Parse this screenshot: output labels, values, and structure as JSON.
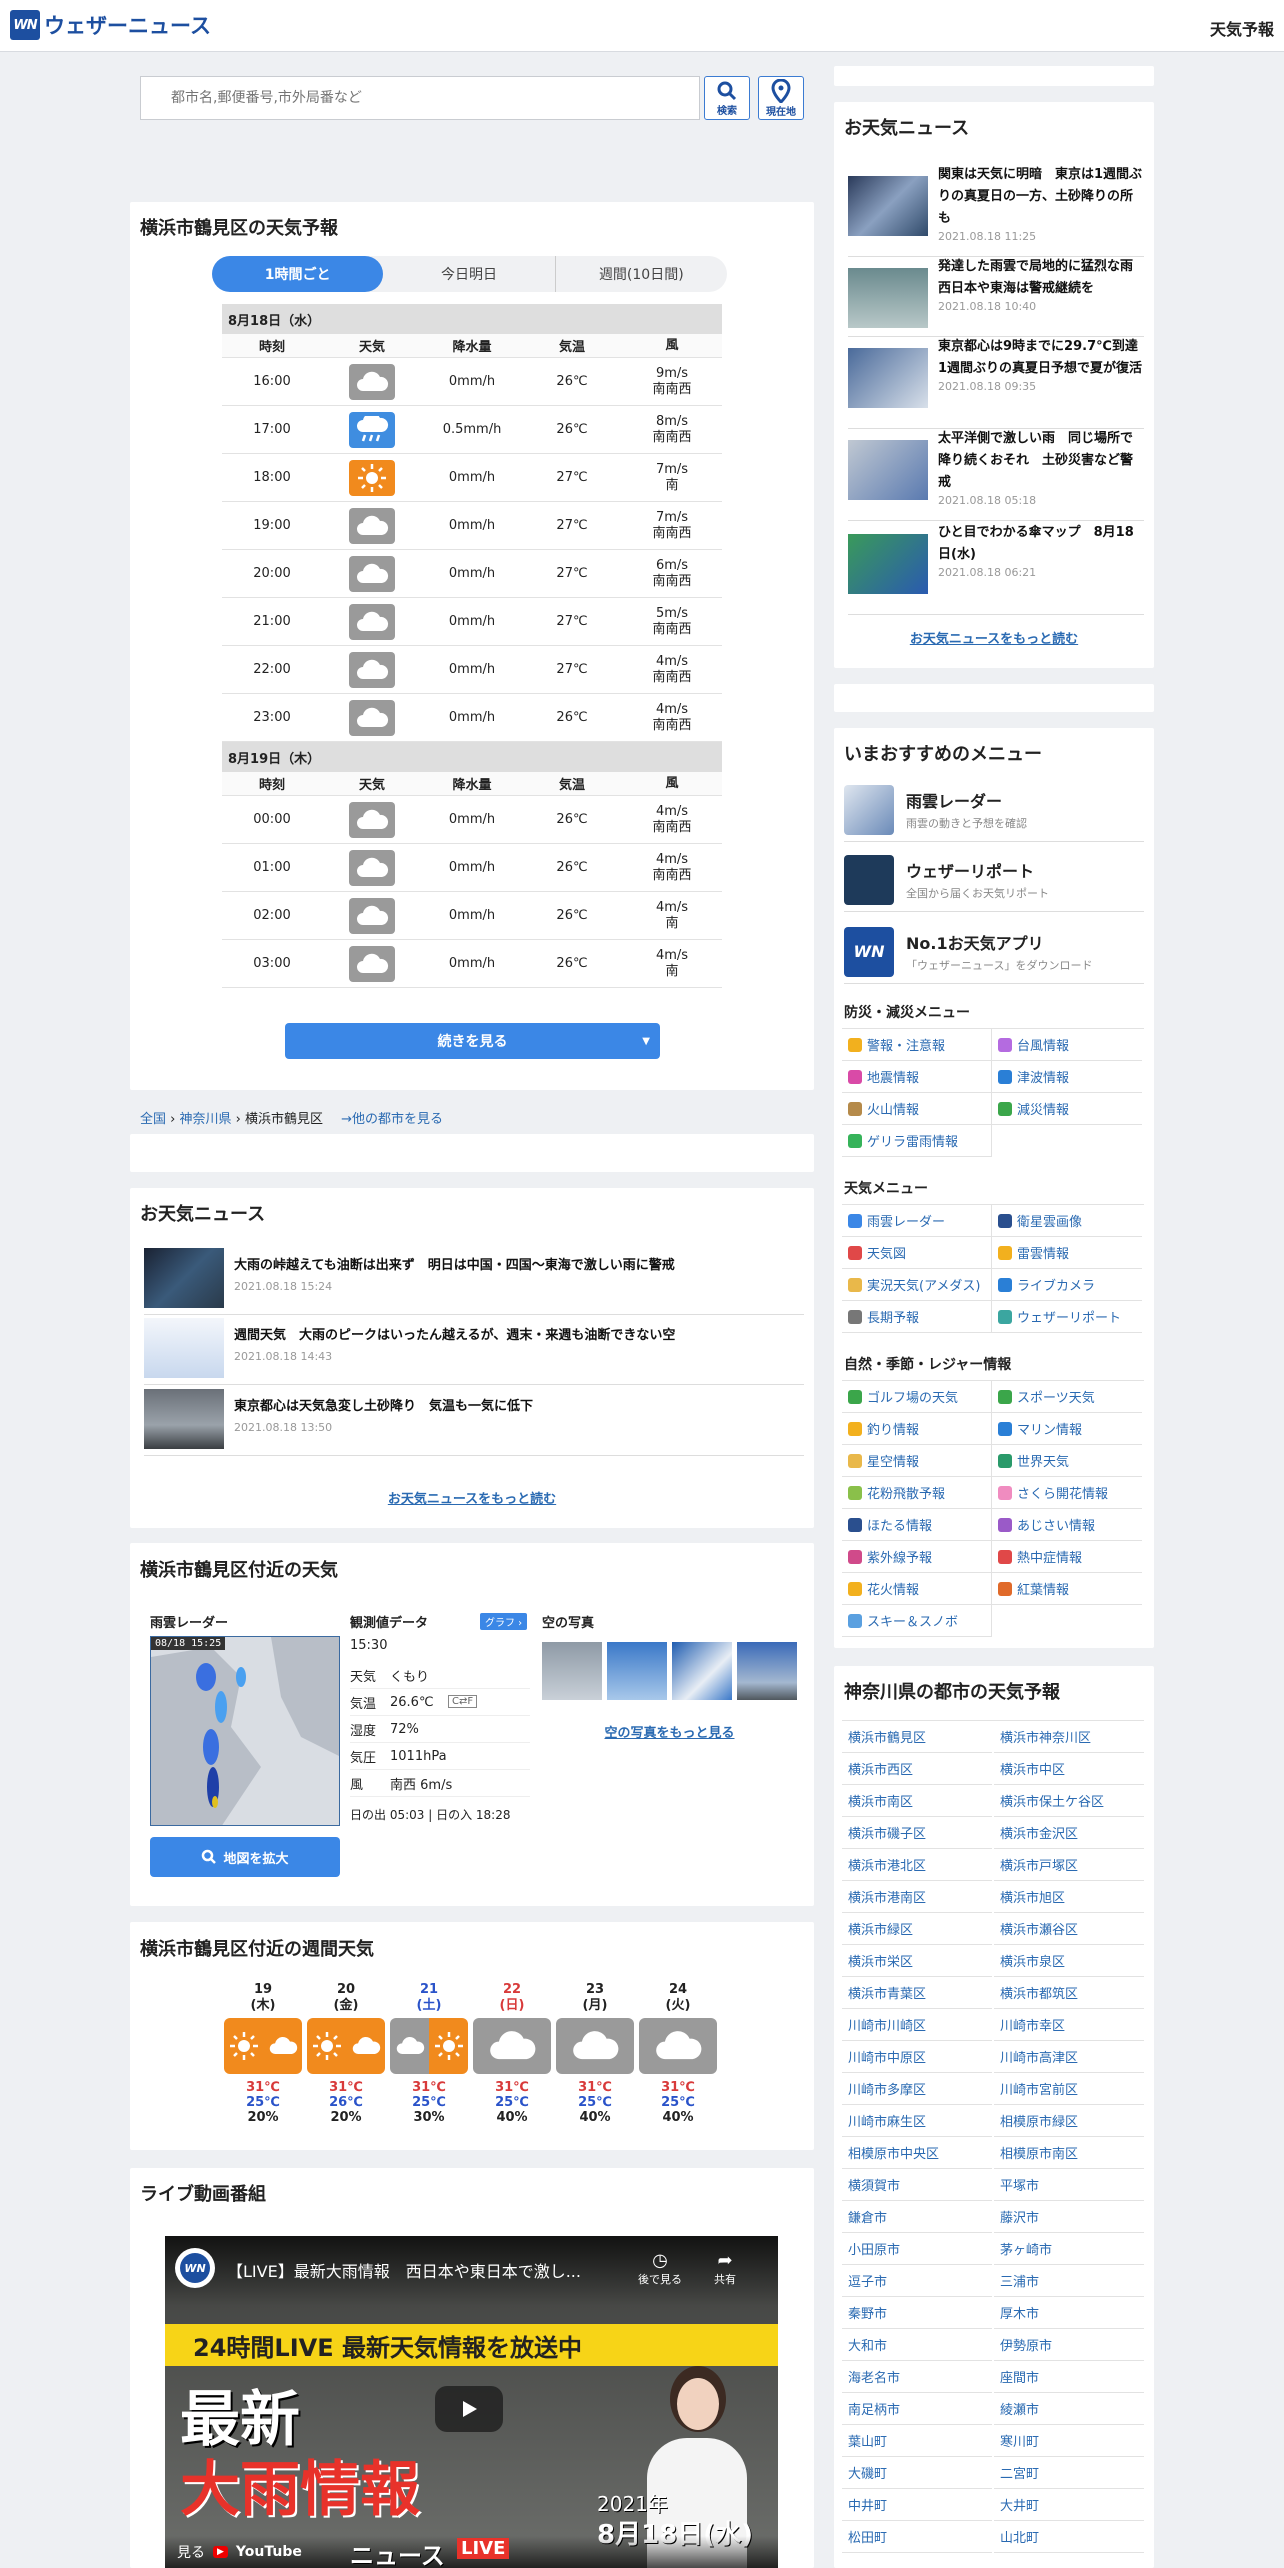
{
  "header": {
    "logo_mark": "WN",
    "logo_text": "ウェザーニュース",
    "right_label": "天気予報"
  },
  "search": {
    "placeholder": "都市名,郵便番号,市外局番など",
    "search_label": "検索",
    "location_label": "現在地"
  },
  "forecast": {
    "title": "横浜市鶴見区の天気予報",
    "tabs": [
      "1時間ごと",
      "今日明日",
      "週間(10日間)"
    ],
    "col_headers": [
      "時刻",
      "天気",
      "降水量",
      "気温",
      "風"
    ],
    "days": [
      {
        "label": "8月18日（水）",
        "rows": [
          {
            "time": "16:00",
            "weather": "cloudy",
            "precip": "0mm/h",
            "temp": "26℃",
            "wind_speed": "9m/s",
            "wind_dir": "南南西"
          },
          {
            "time": "17:00",
            "weather": "rain",
            "precip": "0.5mm/h",
            "temp": "26℃",
            "wind_speed": "8m/s",
            "wind_dir": "南南西"
          },
          {
            "time": "18:00",
            "weather": "sunny",
            "precip": "0mm/h",
            "temp": "27℃",
            "wind_speed": "7m/s",
            "wind_dir": "南"
          },
          {
            "time": "19:00",
            "weather": "cloudy",
            "precip": "0mm/h",
            "temp": "27℃",
            "wind_speed": "7m/s",
            "wind_dir": "南南西"
          },
          {
            "time": "20:00",
            "weather": "cloudy",
            "precip": "0mm/h",
            "temp": "27℃",
            "wind_speed": "6m/s",
            "wind_dir": "南南西"
          },
          {
            "time": "21:00",
            "weather": "cloudy",
            "precip": "0mm/h",
            "temp": "27℃",
            "wind_speed": "5m/s",
            "wind_dir": "南南西"
          },
          {
            "time": "22:00",
            "weather": "cloudy",
            "precip": "0mm/h",
            "temp": "27℃",
            "wind_speed": "4m/s",
            "wind_dir": "南南西"
          },
          {
            "time": "23:00",
            "weather": "cloudy",
            "precip": "0mm/h",
            "temp": "26℃",
            "wind_speed": "4m/s",
            "wind_dir": "南南西"
          }
        ]
      },
      {
        "label": "8月19日（木）",
        "rows": [
          {
            "time": "00:00",
            "weather": "cloudy",
            "precip": "0mm/h",
            "temp": "26℃",
            "wind_speed": "4m/s",
            "wind_dir": "南南西"
          },
          {
            "time": "01:00",
            "weather": "cloudy",
            "precip": "0mm/h",
            "temp": "26℃",
            "wind_speed": "4m/s",
            "wind_dir": "南南西"
          },
          {
            "time": "02:00",
            "weather": "cloudy",
            "precip": "0mm/h",
            "temp": "26℃",
            "wind_speed": "4m/s",
            "wind_dir": "南"
          },
          {
            "time": "03:00",
            "weather": "cloudy",
            "precip": "0mm/h",
            "temp": "26℃",
            "wind_speed": "4m/s",
            "wind_dir": "南"
          }
        ]
      }
    ],
    "more_label": "続きを見る"
  },
  "breadcrumb": {
    "items": [
      "全国",
      "神奈川県",
      "横浜市鶴見区"
    ],
    "other": "→他の都市を見る"
  },
  "news_main": {
    "title": "お天気ニュース",
    "items": [
      {
        "title": "大雨の峠越えても油断は出来ず　明日は中国・四国～東海で激しい雨に警戒",
        "date": "2021.08.18 15:24"
      },
      {
        "title": "週間天気　大雨のピークはいったん越えるが、週末・来週も油断できない空",
        "date": "2021.08.18 14:43"
      },
      {
        "title": "東京都心は天気急変し土砂降り　気温も一気に低下",
        "date": "2021.08.18 13:50"
      }
    ],
    "more": "お天気ニュースをもっと読む"
  },
  "nearby": {
    "title": "横浜市鶴見区付近の天気",
    "radar_label": "雨雲レーダー",
    "radar_stamp": "08/18 15:25",
    "radar_button": "地図を拡大",
    "obs_label": "観測値データ",
    "graph_label": "グラフ",
    "obs_time": "15:30",
    "obs": [
      {
        "k": "天気",
        "v": "くもり"
      },
      {
        "k": "気温",
        "v": "26.6℃"
      },
      {
        "k": "湿度",
        "v": "72%"
      },
      {
        "k": "気圧",
        "v": "1011hPa"
      },
      {
        "k": "風",
        "v": "南西 6m/s"
      }
    ],
    "unit_toggle": "C⇄F",
    "sun": "日の出 05:03 | 日の入 18:28",
    "sky_label": "空の写真",
    "sky_more": "空の写真をもっと見る"
  },
  "weekly": {
    "title": "横浜市鶴見区付近の週間天気",
    "days": [
      {
        "d": "19",
        "w": "(木)",
        "type": "sunny-cloudy",
        "max": "31℃",
        "min": "25℃",
        "pop": "20%"
      },
      {
        "d": "20",
        "w": "(金)",
        "type": "sunny-cloudy",
        "max": "31℃",
        "min": "26℃",
        "pop": "20%"
      },
      {
        "d": "21",
        "w": "(土)",
        "type": "cloudy-sunny",
        "max": "31℃",
        "min": "25℃",
        "pop": "30%"
      },
      {
        "d": "22",
        "w": "(日)",
        "type": "cloudy",
        "max": "31℃",
        "min": "25℃",
        "pop": "40%"
      },
      {
        "d": "23",
        "w": "(月)",
        "type": "cloudy",
        "max": "31℃",
        "min": "25℃",
        "pop": "40%"
      },
      {
        "d": "24",
        "w": "(火)",
        "type": "cloudy",
        "max": "31℃",
        "min": "25℃",
        "pop": "40%"
      }
    ],
    "colors": {
      "sat": "#2a53c9",
      "sun": "#d83a3a"
    }
  },
  "live": {
    "title": "ライブ動画番組",
    "video_title": "【LIVE】最新大雨情報　西日本や東日本で激し...",
    "watch_later": "後で見る",
    "share": "共有",
    "banner": "24時間LIVE 最新天気情報を放送中",
    "big1": "最新",
    "big2": "大雨情報",
    "date_year": "2021年",
    "date_md": "8月18日(水)",
    "watch": "見る",
    "yt": "YouTube",
    "news_word": "ニュース",
    "live_word": "LIVE"
  },
  "right_news": {
    "title": "お天気ニュース",
    "items": [
      {
        "title": "関東は天気に明暗　東京は1週間ぶりの真夏日の一方、土砂降りの所も",
        "date": "2021.08.18 11:25"
      },
      {
        "title": "発達した雨雲で局地的に猛烈な雨　西日本や東海は警戒継続を",
        "date": "2021.08.18 10:40"
      },
      {
        "title": "東京都心は9時までに29.7℃到達　1週間ぶりの真夏日予想で夏が復活",
        "date": "2021.08.18 09:35"
      },
      {
        "title": "太平洋側で激しい雨　同じ場所で降り続くおそれ　土砂災害など警戒",
        "date": "2021.08.18 05:18"
      },
      {
        "title": "ひと目でわかる傘マップ　8月18日(水)",
        "date": "2021.08.18 06:21"
      }
    ],
    "more": "お天気ニュースをもっと読む"
  },
  "recommend": {
    "title": "いまおすすめのメニュー",
    "items": [
      {
        "t": "雨雲レーダー",
        "s": "雨雲の動きと予想を確認"
      },
      {
        "t": "ウェザーリポート",
        "s": "全国から届くお天気リポート"
      },
      {
        "t": "No.1お天気アプリ",
        "s": "「ウェザーニュース」をダウンロード"
      }
    ]
  },
  "menus": [
    {
      "h": "防災・減災メニュー",
      "items": [
        "警報・注意報",
        "台風情報",
        "地震情報",
        "津波情報",
        "火山情報",
        "減災情報",
        "ゲリラ雷雨情報"
      ],
      "colors": [
        "#f2b01e",
        "#b46be0",
        "#d94aa7",
        "#2a7fd6",
        "#b58a4a",
        "#3ba64a",
        "#36b35a"
      ]
    },
    {
      "h": "天気メニュー",
      "items": [
        "雨雲レーダー",
        "衛星雲画像",
        "天気図",
        "雷雲情報",
        "実況天気(アメダス)",
        "ライブカメラ",
        "長期予報",
        "ウェザーリポート"
      ],
      "colors": [
        "#3b87e6",
        "#2a4f8e",
        "#e04848",
        "#f2b01e",
        "#e9b84a",
        "#2a7fd6",
        "#777777",
        "#3ba6a0"
      ]
    },
    {
      "h": "自然・季節・レジャー情報",
      "items": [
        "ゴルフ場の天気",
        "スポーツ天気",
        "釣り情報",
        "マリン情報",
        "星空情報",
        "世界天気",
        "花粉飛散予報",
        "さくら開花情報",
        "ほたる情報",
        "あじさい情報",
        "紫外線予報",
        "熱中症情報",
        "花火情報",
        "紅葉情報",
        "スキー＆スノボ"
      ],
      "colors": [
        "#3ba64a",
        "#3ba64a",
        "#f2b01e",
        "#2a7fd6",
        "#e9b84a",
        "#2a9a6a",
        "#8ac04a",
        "#f08cc0",
        "#2a4f8e",
        "#9a5ac8",
        "#d04a8a",
        "#e04848",
        "#f2b01e",
        "#e06a2a",
        "#5aa0e0"
      ]
    }
  ],
  "cities": {
    "title": "神奈川県の都市の天気予報",
    "list": [
      "横浜市鶴見区",
      "横浜市神奈川区",
      "横浜市西区",
      "横浜市中区",
      "横浜市南区",
      "横浜市保土ケ谷区",
      "横浜市磯子区",
      "横浜市金沢区",
      "横浜市港北区",
      "横浜市戸塚区",
      "横浜市港南区",
      "横浜市旭区",
      "横浜市緑区",
      "横浜市瀬谷区",
      "横浜市栄区",
      "横浜市泉区",
      "横浜市青葉区",
      "横浜市都筑区",
      "川崎市川崎区",
      "川崎市幸区",
      "川崎市中原区",
      "川崎市高津区",
      "川崎市多摩区",
      "川崎市宮前区",
      "川崎市麻生区",
      "相模原市緑区",
      "相模原市中央区",
      "相模原市南区",
      "横須賀市",
      "平塚市",
      "鎌倉市",
      "藤沢市",
      "小田原市",
      "茅ヶ崎市",
      "逗子市",
      "三浦市",
      "秦野市",
      "厚木市",
      "大和市",
      "伊勢原市",
      "海老名市",
      "座間市",
      "南足柄市",
      "綾瀬市",
      "葉山町",
      "寒川町",
      "大磯町",
      "二宮町",
      "中井町",
      "大井町",
      "松田町",
      "山北町"
    ]
  }
}
